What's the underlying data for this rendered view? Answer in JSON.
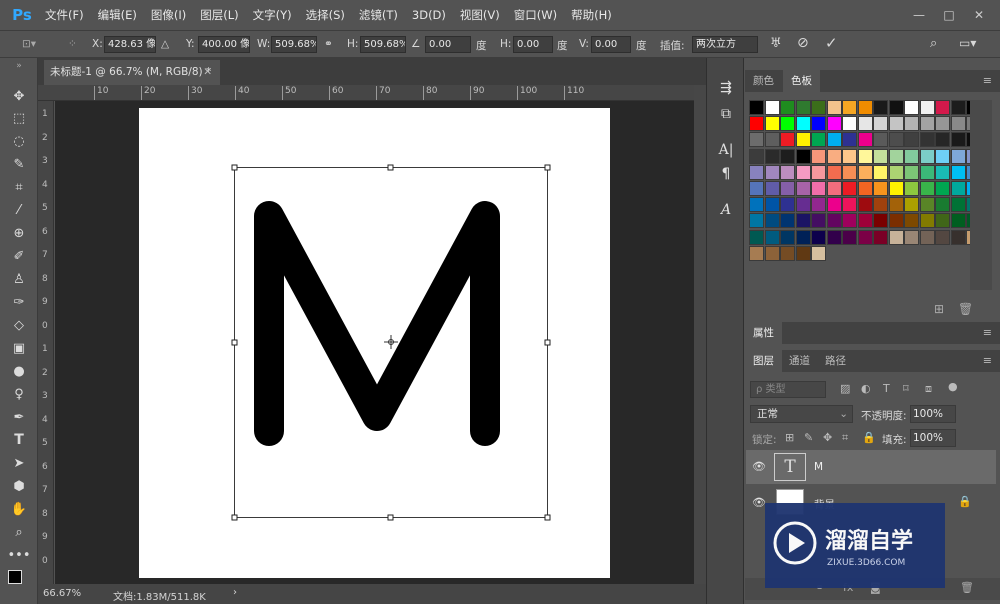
{
  "app": {
    "logo": "Ps"
  },
  "menu": [
    "文件(F)",
    "编辑(E)",
    "图像(I)",
    "图层(L)",
    "文字(Y)",
    "选择(S)",
    "滤镜(T)",
    "3D(D)",
    "视图(V)",
    "窗口(W)",
    "帮助(H)"
  ],
  "window_controls": [
    "—",
    "□",
    "✕"
  ],
  "options": {
    "x_label": "X:",
    "x_value": "428.63 像素",
    "y_label": "Y:",
    "y_value": "400.00 像素",
    "w_label": "W:",
    "w_value": "509.68%",
    "h_label": "H:",
    "h_value": "509.68%",
    "angle_value": "0.00",
    "angle_unit": "度",
    "hskew_label": "H:",
    "hskew_value": "0.00",
    "hskew_unit": "度",
    "vskew_label": "V:",
    "vskew_value": "0.00",
    "vskew_unit": "度",
    "interp_label": "插值:",
    "interp_value": "两次立方"
  },
  "document": {
    "tab_title": "未标题-1 @ 66.7% (M, RGB/8) *",
    "text_layer_content": "M",
    "ruler_top": [
      "10",
      "20",
      "30",
      "40",
      "50",
      "60",
      "70",
      "80",
      "90",
      "100",
      "110"
    ],
    "ruler_left": [
      "1",
      "2",
      "3",
      "4",
      "5",
      "6",
      "7",
      "8",
      "9",
      "0",
      "1",
      "2",
      "3",
      "4",
      "5",
      "6",
      "7",
      "8",
      "9",
      "0"
    ]
  },
  "status": {
    "zoom": "66.67%",
    "doc_info": "文档:1.83M/511.8K",
    "arrow": "›"
  },
  "panels": {
    "top_tabs": [
      "颜色",
      "色板"
    ],
    "properties_tab": "属性",
    "layer_tabs": [
      "图层",
      "通道",
      "路径"
    ],
    "filter_kind": "ρ 类型",
    "blend_mode": "正常",
    "opacity_label": "不透明度:",
    "opacity_value": "100%",
    "lock_label": "锁定:",
    "fill_label": "填充:",
    "fill_value": "100%",
    "layers": [
      {
        "name": "M",
        "type": "text",
        "thumb": "T"
      },
      {
        "name": "背景",
        "type": "background"
      }
    ]
  },
  "swatches": [
    [
      "#000000",
      "#ffffff",
      "#1f8c1f",
      "#2f7a2f",
      "#3b6e1a",
      "#f2c28c",
      "#f5a623",
      "#f08c00",
      "#1a1a1a",
      "#111111",
      "#ffffff",
      "#f0f0f0",
      "#d3194b",
      "#1c1c1c",
      "#000000"
    ],
    [
      "#ff0000",
      "#ffff00",
      "#00ff00",
      "#00ffff",
      "#0000ff",
      "#ff00ff",
      "#ffffff",
      "#e6e6e6",
      "#d4d4d4",
      "#c4c4c4",
      "#b3b3b3",
      "#a3a3a3",
      "#969696",
      "#898989",
      "#7a7a7a"
    ],
    [
      "#6c6c6c",
      "#5e5e5e",
      "#ed1c24",
      "#fff200",
      "#00a651",
      "#00aeef",
      "#2e3192",
      "#ec008c",
      "#5a5a5a",
      "#4d4d4d",
      "#404040",
      "#333333",
      "#262626",
      "#1a1a1a",
      "#0d0d0d"
    ],
    [
      "#3c3c3c",
      "#2b2b2b",
      "#1e1e1e",
      "#000000",
      "#f7977a",
      "#f9ad81",
      "#fdc68a",
      "#fff79a",
      "#c4df9b",
      "#a2d39c",
      "#82ca9d",
      "#7bcdc8",
      "#6ecff6",
      "#7ea7d8",
      "#8493ca"
    ],
    [
      "#8882be",
      "#a187be",
      "#bc8dbf",
      "#f49ac2",
      "#f6989d",
      "#f26c4f",
      "#f68e55",
      "#fbaf5c",
      "#fff467",
      "#acd372",
      "#7cc576",
      "#3bb878",
      "#1abbb4",
      "#00bff3",
      "#438ccb"
    ],
    [
      "#5574b9",
      "#605ca8",
      "#855fa8",
      "#a763a8",
      "#f06ea9",
      "#f26d7d",
      "#ed1c24",
      "#f26522",
      "#f7941d",
      "#fff200",
      "#8dc73f",
      "#39b54a",
      "#00a651",
      "#00a99d",
      "#00aeef"
    ],
    [
      "#0072bc",
      "#0054a6",
      "#2e3192",
      "#662d91",
      "#92278f",
      "#ec008c",
      "#ed145b",
      "#9e0b0f",
      "#a0410d",
      "#a36209",
      "#aba000",
      "#598527",
      "#197b30",
      "#007236",
      "#00746b"
    ],
    [
      "#0076a3",
      "#004b80",
      "#003471",
      "#1b1464",
      "#440e62",
      "#630460",
      "#9e005d",
      "#9e0039",
      "#790000",
      "#7b2e00",
      "#7d4900",
      "#827b00",
      "#406618",
      "#005e20",
      "#005826"
    ],
    [
      "#005952",
      "#005b7f",
      "#003663",
      "#002157",
      "#0d004c",
      "#32004b",
      "#4b0049",
      "#7b0046",
      "#7a0026",
      "#c7b299",
      "#998675",
      "#736357",
      "#534741",
      "#37302d",
      "#c69c6d"
    ],
    [
      "#a67c52",
      "#8c6239",
      "#754c24",
      "#603913",
      "#d5bf9f"
    ]
  ]
}
